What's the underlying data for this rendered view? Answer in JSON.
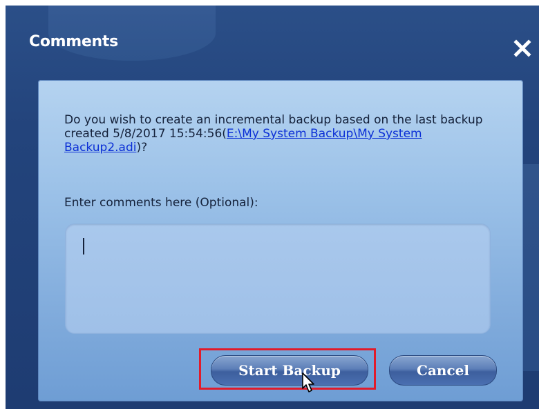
{
  "dialog": {
    "title": "Comments",
    "close_icon": "close-icon"
  },
  "message": {
    "line_prefix": "Do you wish to create an incremental backup based on the last backup created 5/8/2017 15:54:56(",
    "link_text": "E:\\My System Backup\\My System Backup2.adi",
    "line_suffix": ")?"
  },
  "comments": {
    "label": "Enter comments here (Optional):",
    "value": "",
    "placeholder": ""
  },
  "buttons": {
    "start_label": "Start Backup",
    "cancel_label": "Cancel"
  },
  "colors": {
    "accent_highlight": "#e21b2a",
    "dialog_bg": "#23447c",
    "panel_bg": "#9bc1e8",
    "link": "#0b2fd6"
  },
  "icons": {
    "cursor": "pointer-cursor-icon"
  }
}
